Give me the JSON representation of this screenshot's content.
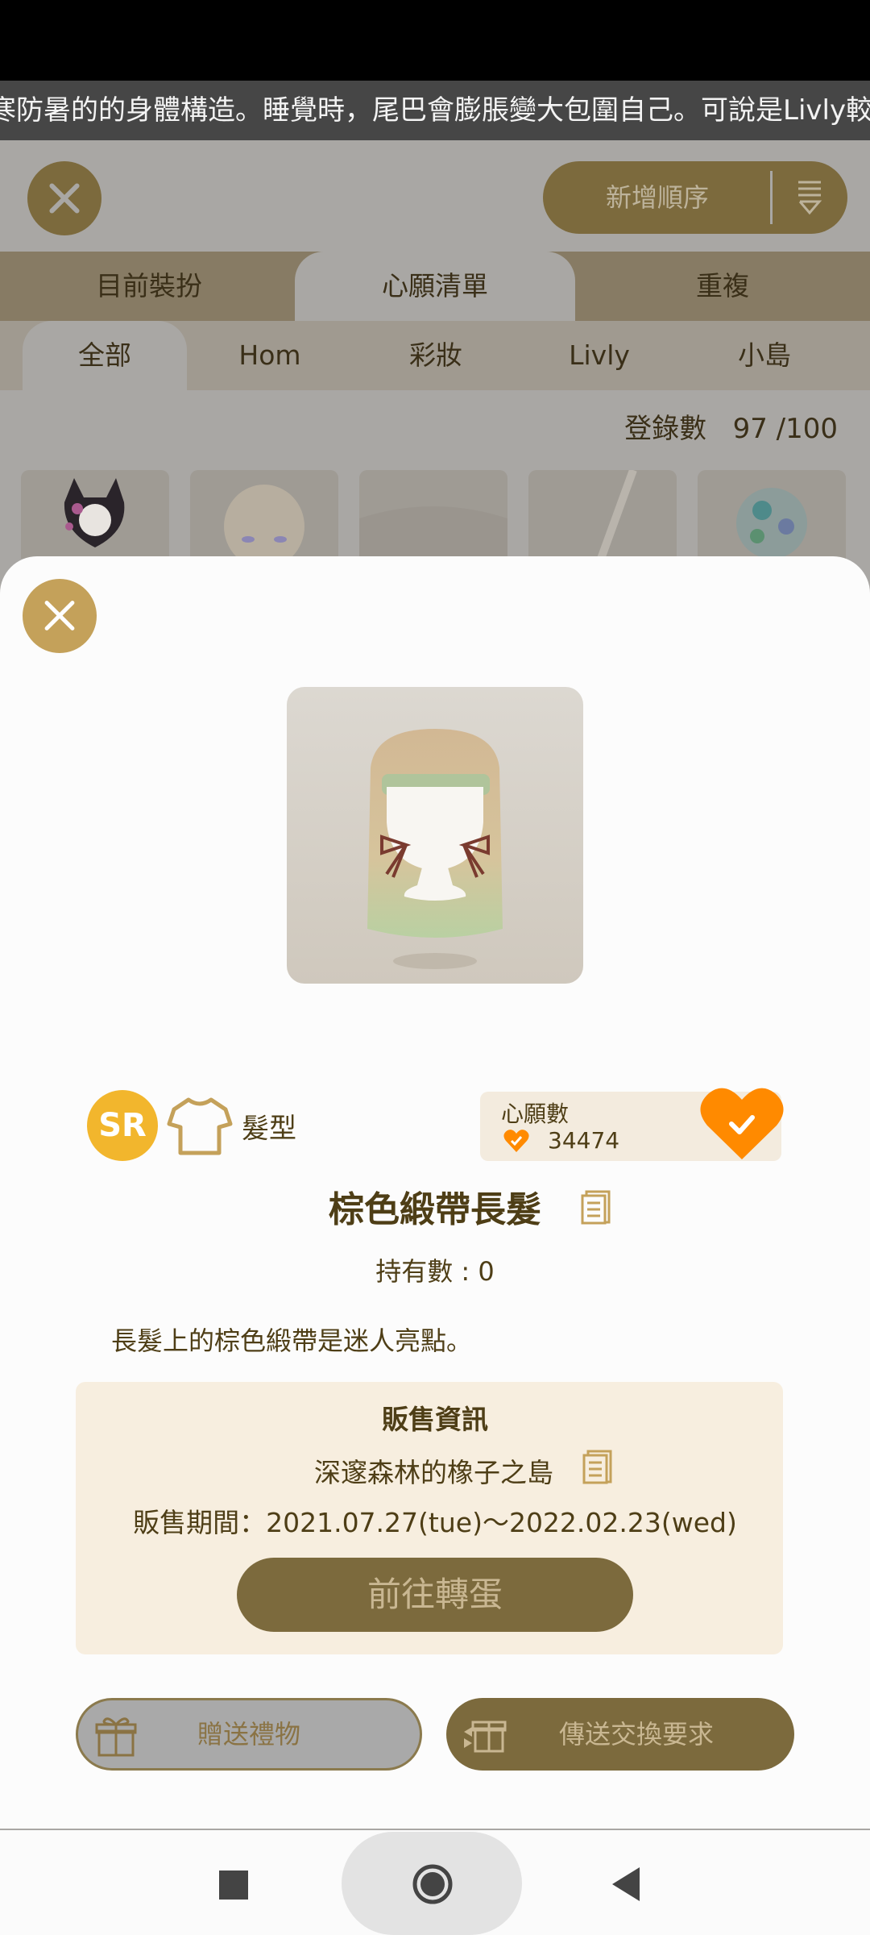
{
  "ticker": {
    "text": "寒防暑的的身體構造。睡覺時，尾巴會膨脹變大包圍自己。可說是Livly較"
  },
  "header": {
    "add_order_label": "新增順序"
  },
  "tabs": [
    "目前裝扮",
    "心願清單",
    "重複"
  ],
  "active_tab": 1,
  "subtabs": [
    "全部",
    "Hom",
    "彩妝",
    "Livly",
    "小島"
  ],
  "active_subtab": 0,
  "registration": {
    "label": "登錄數",
    "value": "97 /100"
  },
  "item": {
    "rarity": "SR",
    "category": "髮型",
    "wish_label": "心願數",
    "wish_count": "34474",
    "name": "棕色緞帶長髮",
    "owned": "持有數 : 0",
    "description": "長髮上的棕色緞帶是迷人亮點。"
  },
  "sale": {
    "title": "販售資訊",
    "location": "深邃森林的橡子之島",
    "period": "販售期間：2021.07.27(tue)～2022.02.23(wed)",
    "gacha_button": "前往轉蛋"
  },
  "actions": {
    "gift_button": "贈送禮物",
    "trade_button": "傳送交換要求"
  },
  "icons": [
    "close-icon",
    "sort-icon",
    "shirt-icon",
    "heart-icon",
    "document-icon",
    "gift-icon",
    "exchange-icon",
    "nav-recent-icon",
    "nav-home-icon",
    "nav-back-icon"
  ],
  "colors": {
    "gold": "#c4a15a",
    "brown": "#7c6a3d",
    "heart": "#ff8a00",
    "rarity": "#f2b62d",
    "sheet": "#fcfcfc"
  }
}
